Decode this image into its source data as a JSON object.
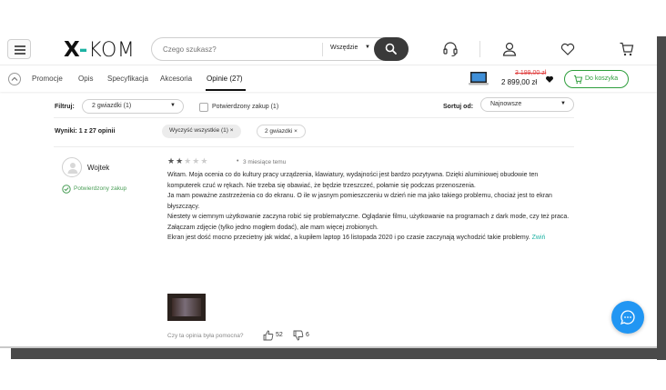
{
  "header": {
    "logo_x": "X",
    "logo_kom": "KOM",
    "search": {
      "placeholder": "Czego szukasz?",
      "scope": "Wszędzie"
    }
  },
  "tabs": {
    "items": [
      "Promocje",
      "Opis",
      "Specyfikacja",
      "Akcesoria",
      "Opinie (27)"
    ],
    "active": "Opinie (27)"
  },
  "product_bar": {
    "old_price": "3 199,00 zł",
    "new_price": "2 899,00 zł",
    "cart_label": "Do koszyka"
  },
  "filters": {
    "filter_label": "Filtruj:",
    "rating_value": "2 gwiazdki (1)",
    "verified_label": "Potwierdzony zakup (1)",
    "sort_label": "Sortuj od:",
    "sort_value": "Najnowsze"
  },
  "results": {
    "summary": "Wyniki: 1 z 27 opinii",
    "clear_chip": "Wyczyść wszystkie (1) ×",
    "active_chip": "2 gwiazdki ×"
  },
  "review": {
    "author": "Wojtek",
    "verified": "Potwierdzony zakup",
    "rating": 2,
    "rating_max": 5,
    "time": "3 miesiące temu",
    "paragraphs": [
      "Witam. Moja ocenia co do kultury pracy urządzenia, klawiatury, wydajności jest bardzo pozytywna. Dzięki aluminiowej obudowie ten komputerek czuć w rękach. Nie trzeba się obawiać, że będzie trzeszczeć, połamie się podczas przenoszenia.",
      "Ja mam poważne zastrzeżenia co do ekranu. O ile w jasnym pomieszczeniu w dzień nie ma jako takiego problemu, chociaż jest to ekran błyszczący.",
      "Niestety w ciemnym użytkowanie zaczyna robić się problematyczne. Oglądanie filmu, użytkowanie na programach z dark mode, czy też praca. Załączam zdjęcie (tylko jedno mogłem dodać), ale mam więcej zrobionych.",
      "Ekran jest dość mocno przecietny jak widać, a kupiłem laptop 16 listopada 2020 i po czasie zaczynają wychodzić takie problemy."
    ],
    "collapse_label": "Zwiń",
    "helpful_question": "Czy ta opinia była pomocna?",
    "upvotes": "52",
    "downvotes": "6"
  },
  "colors": {
    "brand": "#1db2a3",
    "cart_green": "#2e9e3c",
    "old_price_red": "#e04444",
    "chat_blue": "#2196f3"
  },
  "icons": [
    "menu-icon",
    "search-icon",
    "headset-icon",
    "user-icon",
    "heart-icon",
    "cart-icon",
    "chevron-up-icon",
    "chat-icon",
    "thumb-up-icon",
    "thumb-down-icon",
    "check-circle-icon"
  ]
}
